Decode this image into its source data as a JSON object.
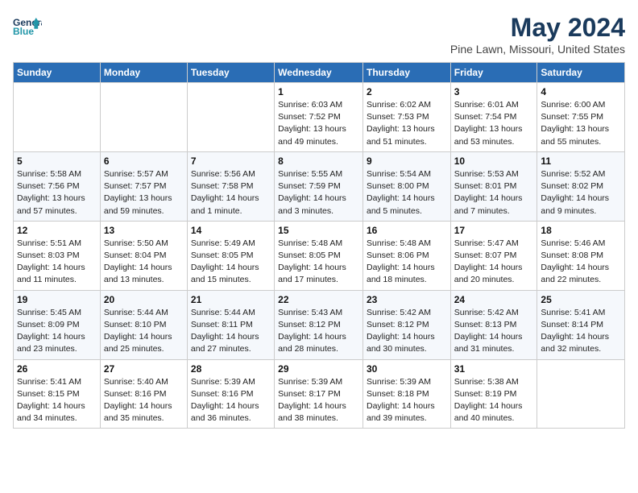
{
  "header": {
    "logo_line1": "General",
    "logo_line2": "Blue",
    "title": "May 2024",
    "subtitle": "Pine Lawn, Missouri, United States"
  },
  "calendar": {
    "columns": [
      "Sunday",
      "Monday",
      "Tuesday",
      "Wednesday",
      "Thursday",
      "Friday",
      "Saturday"
    ],
    "weeks": [
      [
        {
          "day": "",
          "info": ""
        },
        {
          "day": "",
          "info": ""
        },
        {
          "day": "",
          "info": ""
        },
        {
          "day": "1",
          "info": "Sunrise: 6:03 AM\nSunset: 7:52 PM\nDaylight: 13 hours\nand 49 minutes."
        },
        {
          "day": "2",
          "info": "Sunrise: 6:02 AM\nSunset: 7:53 PM\nDaylight: 13 hours\nand 51 minutes."
        },
        {
          "day": "3",
          "info": "Sunrise: 6:01 AM\nSunset: 7:54 PM\nDaylight: 13 hours\nand 53 minutes."
        },
        {
          "day": "4",
          "info": "Sunrise: 6:00 AM\nSunset: 7:55 PM\nDaylight: 13 hours\nand 55 minutes."
        }
      ],
      [
        {
          "day": "5",
          "info": "Sunrise: 5:58 AM\nSunset: 7:56 PM\nDaylight: 13 hours\nand 57 minutes."
        },
        {
          "day": "6",
          "info": "Sunrise: 5:57 AM\nSunset: 7:57 PM\nDaylight: 13 hours\nand 59 minutes."
        },
        {
          "day": "7",
          "info": "Sunrise: 5:56 AM\nSunset: 7:58 PM\nDaylight: 14 hours\nand 1 minute."
        },
        {
          "day": "8",
          "info": "Sunrise: 5:55 AM\nSunset: 7:59 PM\nDaylight: 14 hours\nand 3 minutes."
        },
        {
          "day": "9",
          "info": "Sunrise: 5:54 AM\nSunset: 8:00 PM\nDaylight: 14 hours\nand 5 minutes."
        },
        {
          "day": "10",
          "info": "Sunrise: 5:53 AM\nSunset: 8:01 PM\nDaylight: 14 hours\nand 7 minutes."
        },
        {
          "day": "11",
          "info": "Sunrise: 5:52 AM\nSunset: 8:02 PM\nDaylight: 14 hours\nand 9 minutes."
        }
      ],
      [
        {
          "day": "12",
          "info": "Sunrise: 5:51 AM\nSunset: 8:03 PM\nDaylight: 14 hours\nand 11 minutes."
        },
        {
          "day": "13",
          "info": "Sunrise: 5:50 AM\nSunset: 8:04 PM\nDaylight: 14 hours\nand 13 minutes."
        },
        {
          "day": "14",
          "info": "Sunrise: 5:49 AM\nSunset: 8:05 PM\nDaylight: 14 hours\nand 15 minutes."
        },
        {
          "day": "15",
          "info": "Sunrise: 5:48 AM\nSunset: 8:05 PM\nDaylight: 14 hours\nand 17 minutes."
        },
        {
          "day": "16",
          "info": "Sunrise: 5:48 AM\nSunset: 8:06 PM\nDaylight: 14 hours\nand 18 minutes."
        },
        {
          "day": "17",
          "info": "Sunrise: 5:47 AM\nSunset: 8:07 PM\nDaylight: 14 hours\nand 20 minutes."
        },
        {
          "day": "18",
          "info": "Sunrise: 5:46 AM\nSunset: 8:08 PM\nDaylight: 14 hours\nand 22 minutes."
        }
      ],
      [
        {
          "day": "19",
          "info": "Sunrise: 5:45 AM\nSunset: 8:09 PM\nDaylight: 14 hours\nand 23 minutes."
        },
        {
          "day": "20",
          "info": "Sunrise: 5:44 AM\nSunset: 8:10 PM\nDaylight: 14 hours\nand 25 minutes."
        },
        {
          "day": "21",
          "info": "Sunrise: 5:44 AM\nSunset: 8:11 PM\nDaylight: 14 hours\nand 27 minutes."
        },
        {
          "day": "22",
          "info": "Sunrise: 5:43 AM\nSunset: 8:12 PM\nDaylight: 14 hours\nand 28 minutes."
        },
        {
          "day": "23",
          "info": "Sunrise: 5:42 AM\nSunset: 8:12 PM\nDaylight: 14 hours\nand 30 minutes."
        },
        {
          "day": "24",
          "info": "Sunrise: 5:42 AM\nSunset: 8:13 PM\nDaylight: 14 hours\nand 31 minutes."
        },
        {
          "day": "25",
          "info": "Sunrise: 5:41 AM\nSunset: 8:14 PM\nDaylight: 14 hours\nand 32 minutes."
        }
      ],
      [
        {
          "day": "26",
          "info": "Sunrise: 5:41 AM\nSunset: 8:15 PM\nDaylight: 14 hours\nand 34 minutes."
        },
        {
          "day": "27",
          "info": "Sunrise: 5:40 AM\nSunset: 8:16 PM\nDaylight: 14 hours\nand 35 minutes."
        },
        {
          "day": "28",
          "info": "Sunrise: 5:39 AM\nSunset: 8:16 PM\nDaylight: 14 hours\nand 36 minutes."
        },
        {
          "day": "29",
          "info": "Sunrise: 5:39 AM\nSunset: 8:17 PM\nDaylight: 14 hours\nand 38 minutes."
        },
        {
          "day": "30",
          "info": "Sunrise: 5:39 AM\nSunset: 8:18 PM\nDaylight: 14 hours\nand 39 minutes."
        },
        {
          "day": "31",
          "info": "Sunrise: 5:38 AM\nSunset: 8:19 PM\nDaylight: 14 hours\nand 40 minutes."
        },
        {
          "day": "",
          "info": ""
        }
      ]
    ]
  }
}
